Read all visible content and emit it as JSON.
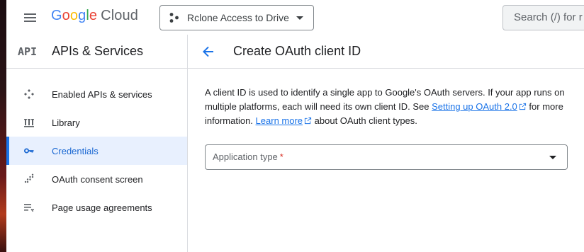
{
  "header": {
    "logo_letters": [
      "G",
      "o",
      "o",
      "g",
      "l",
      "e"
    ],
    "logo_product": "Cloud",
    "project_name": "Rclone Access to Drive",
    "search_placeholder": "Search (/) for r"
  },
  "sidebar": {
    "api_badge": "API",
    "title": "APIs & Services",
    "items": [
      {
        "label": "Enabled APIs & services",
        "icon": "enabled-apis-icon",
        "active": false
      },
      {
        "label": "Library",
        "icon": "library-icon",
        "active": false
      },
      {
        "label": "Credentials",
        "icon": "key-icon",
        "active": true
      },
      {
        "label": "OAuth consent screen",
        "icon": "consent-icon",
        "active": false
      },
      {
        "label": "Page usage agreements",
        "icon": "agreements-icon",
        "active": false
      }
    ]
  },
  "main": {
    "title": "Create OAuth client ID",
    "desc_part1": "A client ID is used to identify a single app to Google's OAuth servers. If your app runs on multiple platforms, each will need its own client ID. See ",
    "link1": "Setting up OAuth 2.0",
    "desc_part2": " for more information. ",
    "link2": "Learn more",
    "desc_part3": " about OAuth client types.",
    "app_type_label": "Application type",
    "required_mark": "*"
  },
  "colors": {
    "accent": "#1a73e8",
    "active_bg": "#e8f0fe",
    "required": "#d93025"
  }
}
